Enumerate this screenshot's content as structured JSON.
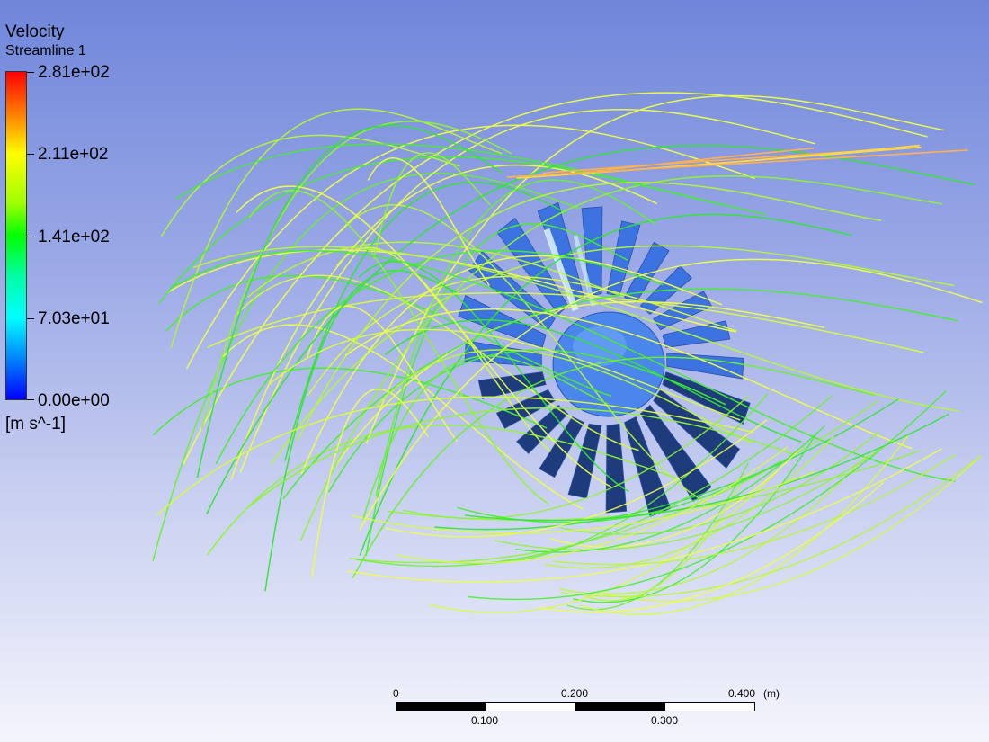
{
  "legend": {
    "title": "Velocity",
    "subtitle": "Streamline 1",
    "ticks": [
      "2.81e+02",
      "2.11e+02",
      "1.41e+02",
      "7.03e+01",
      "0.00e+00"
    ],
    "units": "[m s^-1]"
  },
  "scale_bar": {
    "top_labels": [
      "0",
      "0.200",
      "0.400"
    ],
    "unit": "(m)",
    "bottom_labels": [
      "0.100",
      "0.300"
    ]
  },
  "colors": {
    "background_top": "#6f86da",
    "background_bottom": "#f4f5fc",
    "blade": "#3d73e0",
    "blade_shadow": "#1e3c7c",
    "streamline_green": "#2ee632",
    "streamline_yellow": "#e8ff40"
  }
}
